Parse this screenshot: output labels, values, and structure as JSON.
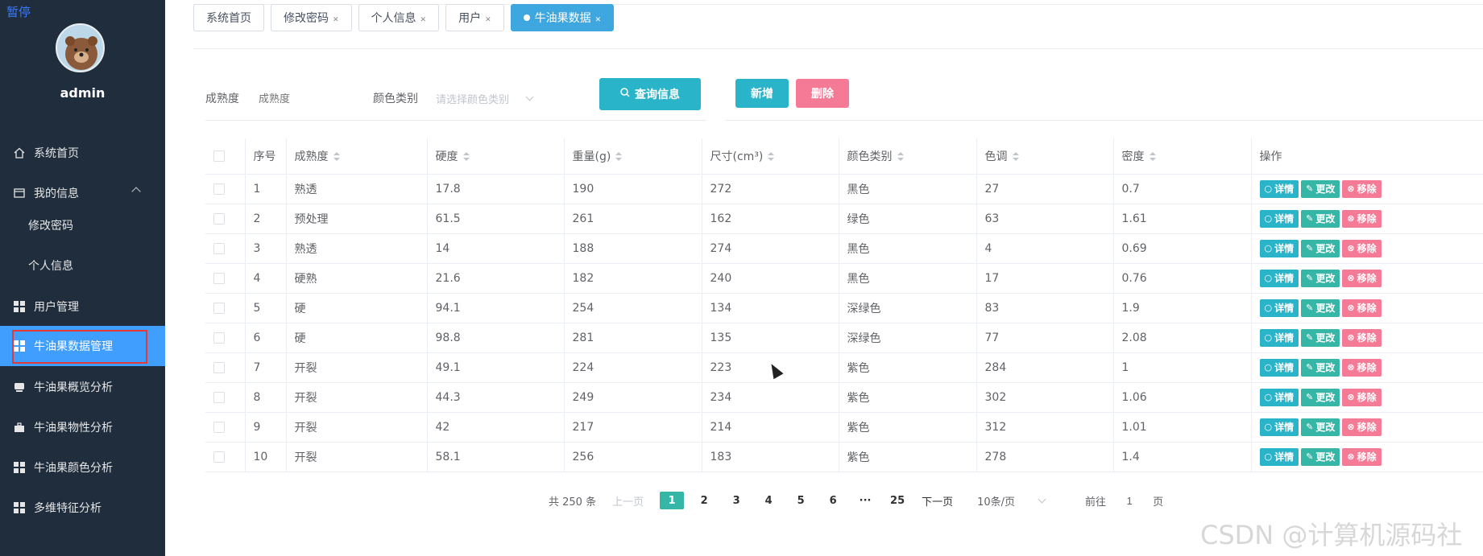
{
  "overlay": {
    "pause_label": "暂停"
  },
  "sidebar": {
    "username": "admin",
    "items": [
      {
        "label": "系统首页",
        "icon": "home-icon"
      },
      {
        "label": "我的信息",
        "icon": "profile-card-icon"
      },
      {
        "label": "修改密码"
      },
      {
        "label": "个人信息"
      },
      {
        "label": "用户管理",
        "icon": "grid-icon"
      },
      {
        "label": "牛油果数据管理",
        "icon": "grid-icon"
      },
      {
        "label": "牛油果概览分析",
        "icon": "chat-icon"
      },
      {
        "label": "牛油果物性分析",
        "icon": "briefcase-icon"
      },
      {
        "label": "牛油果颜色分析",
        "icon": "grid-icon"
      },
      {
        "label": "多维特征分析",
        "icon": "grid-icon"
      }
    ]
  },
  "tabs": [
    {
      "label": "系统首页"
    },
    {
      "label": "修改密码"
    },
    {
      "label": "个人信息"
    },
    {
      "label": "用户"
    },
    {
      "label": "牛油果数据"
    }
  ],
  "search": {
    "ripeness_label": "成熟度",
    "ripeness_placeholder": "成熟度",
    "color_label": "颜色类别",
    "color_placeholder": "请选择颜色类别",
    "query_button": "查询信息",
    "add_button": "新增",
    "delete_button": "删除"
  },
  "table": {
    "headers": [
      "序号",
      "成熟度",
      "硬度",
      "重量(g)",
      "尺寸(cm³)",
      "颜色类别",
      "色调",
      "密度",
      "操作"
    ],
    "action_labels": {
      "detail": "详情",
      "edit": "更改",
      "remove": "移除"
    },
    "rows": [
      [
        "1",
        "熟透",
        "17.8",
        "190",
        "272",
        "黑色",
        "27",
        "0.7"
      ],
      [
        "2",
        "预处理",
        "61.5",
        "261",
        "162",
        "绿色",
        "63",
        "1.61"
      ],
      [
        "3",
        "熟透",
        "14",
        "188",
        "274",
        "黑色",
        "4",
        "0.69"
      ],
      [
        "4",
        "硬熟",
        "21.6",
        "182",
        "240",
        "黑色",
        "17",
        "0.76"
      ],
      [
        "5",
        "硬",
        "94.1",
        "254",
        "134",
        "深绿色",
        "83",
        "1.9"
      ],
      [
        "6",
        "硬",
        "98.8",
        "281",
        "135",
        "深绿色",
        "77",
        "2.08"
      ],
      [
        "7",
        "开裂",
        "49.1",
        "224",
        "223",
        "紫色",
        "284",
        "1"
      ],
      [
        "8",
        "开裂",
        "44.3",
        "249",
        "234",
        "紫色",
        "302",
        "1.06"
      ],
      [
        "9",
        "开裂",
        "42",
        "217",
        "214",
        "紫色",
        "312",
        "1.01"
      ],
      [
        "10",
        "开裂",
        "58.1",
        "256",
        "183",
        "紫色",
        "278",
        "1.4"
      ]
    ]
  },
  "pagination": {
    "total": "共 250 条",
    "prev": "上一页",
    "pages": [
      "1",
      "2",
      "3",
      "4",
      "5",
      "6",
      "···",
      "25"
    ],
    "current": "1",
    "next": "下一页",
    "page_size": "10条/页",
    "goto_label": "前往",
    "goto_value": "1",
    "goto_suffix": "页"
  },
  "watermark": "CSDN @计算机源码社"
}
